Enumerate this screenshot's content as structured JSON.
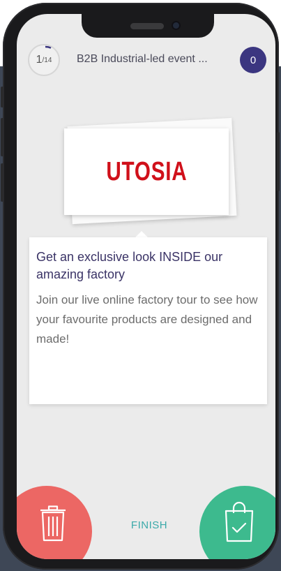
{
  "header": {
    "progress_current": "1",
    "progress_total": "14",
    "event_title": "B2B Industrial-led event ...",
    "count_badge": "0"
  },
  "logo": {
    "text": "UTOSIA"
  },
  "content": {
    "title": "Get an exclusive look INSIDE our amazing factory",
    "body": "Join our live online factory tour to see how your favourite products are designed and made!"
  },
  "actions": {
    "finish_label": "FINISH",
    "discard_icon": "trash-icon",
    "save_icon": "shopping-bag-check-icon"
  },
  "colors": {
    "badge": "#3b3680",
    "title": "#3a3366",
    "discard": "#ec6764",
    "save": "#3dba8e",
    "finish": "#3aa9a9",
    "logo": "#d0101a"
  }
}
